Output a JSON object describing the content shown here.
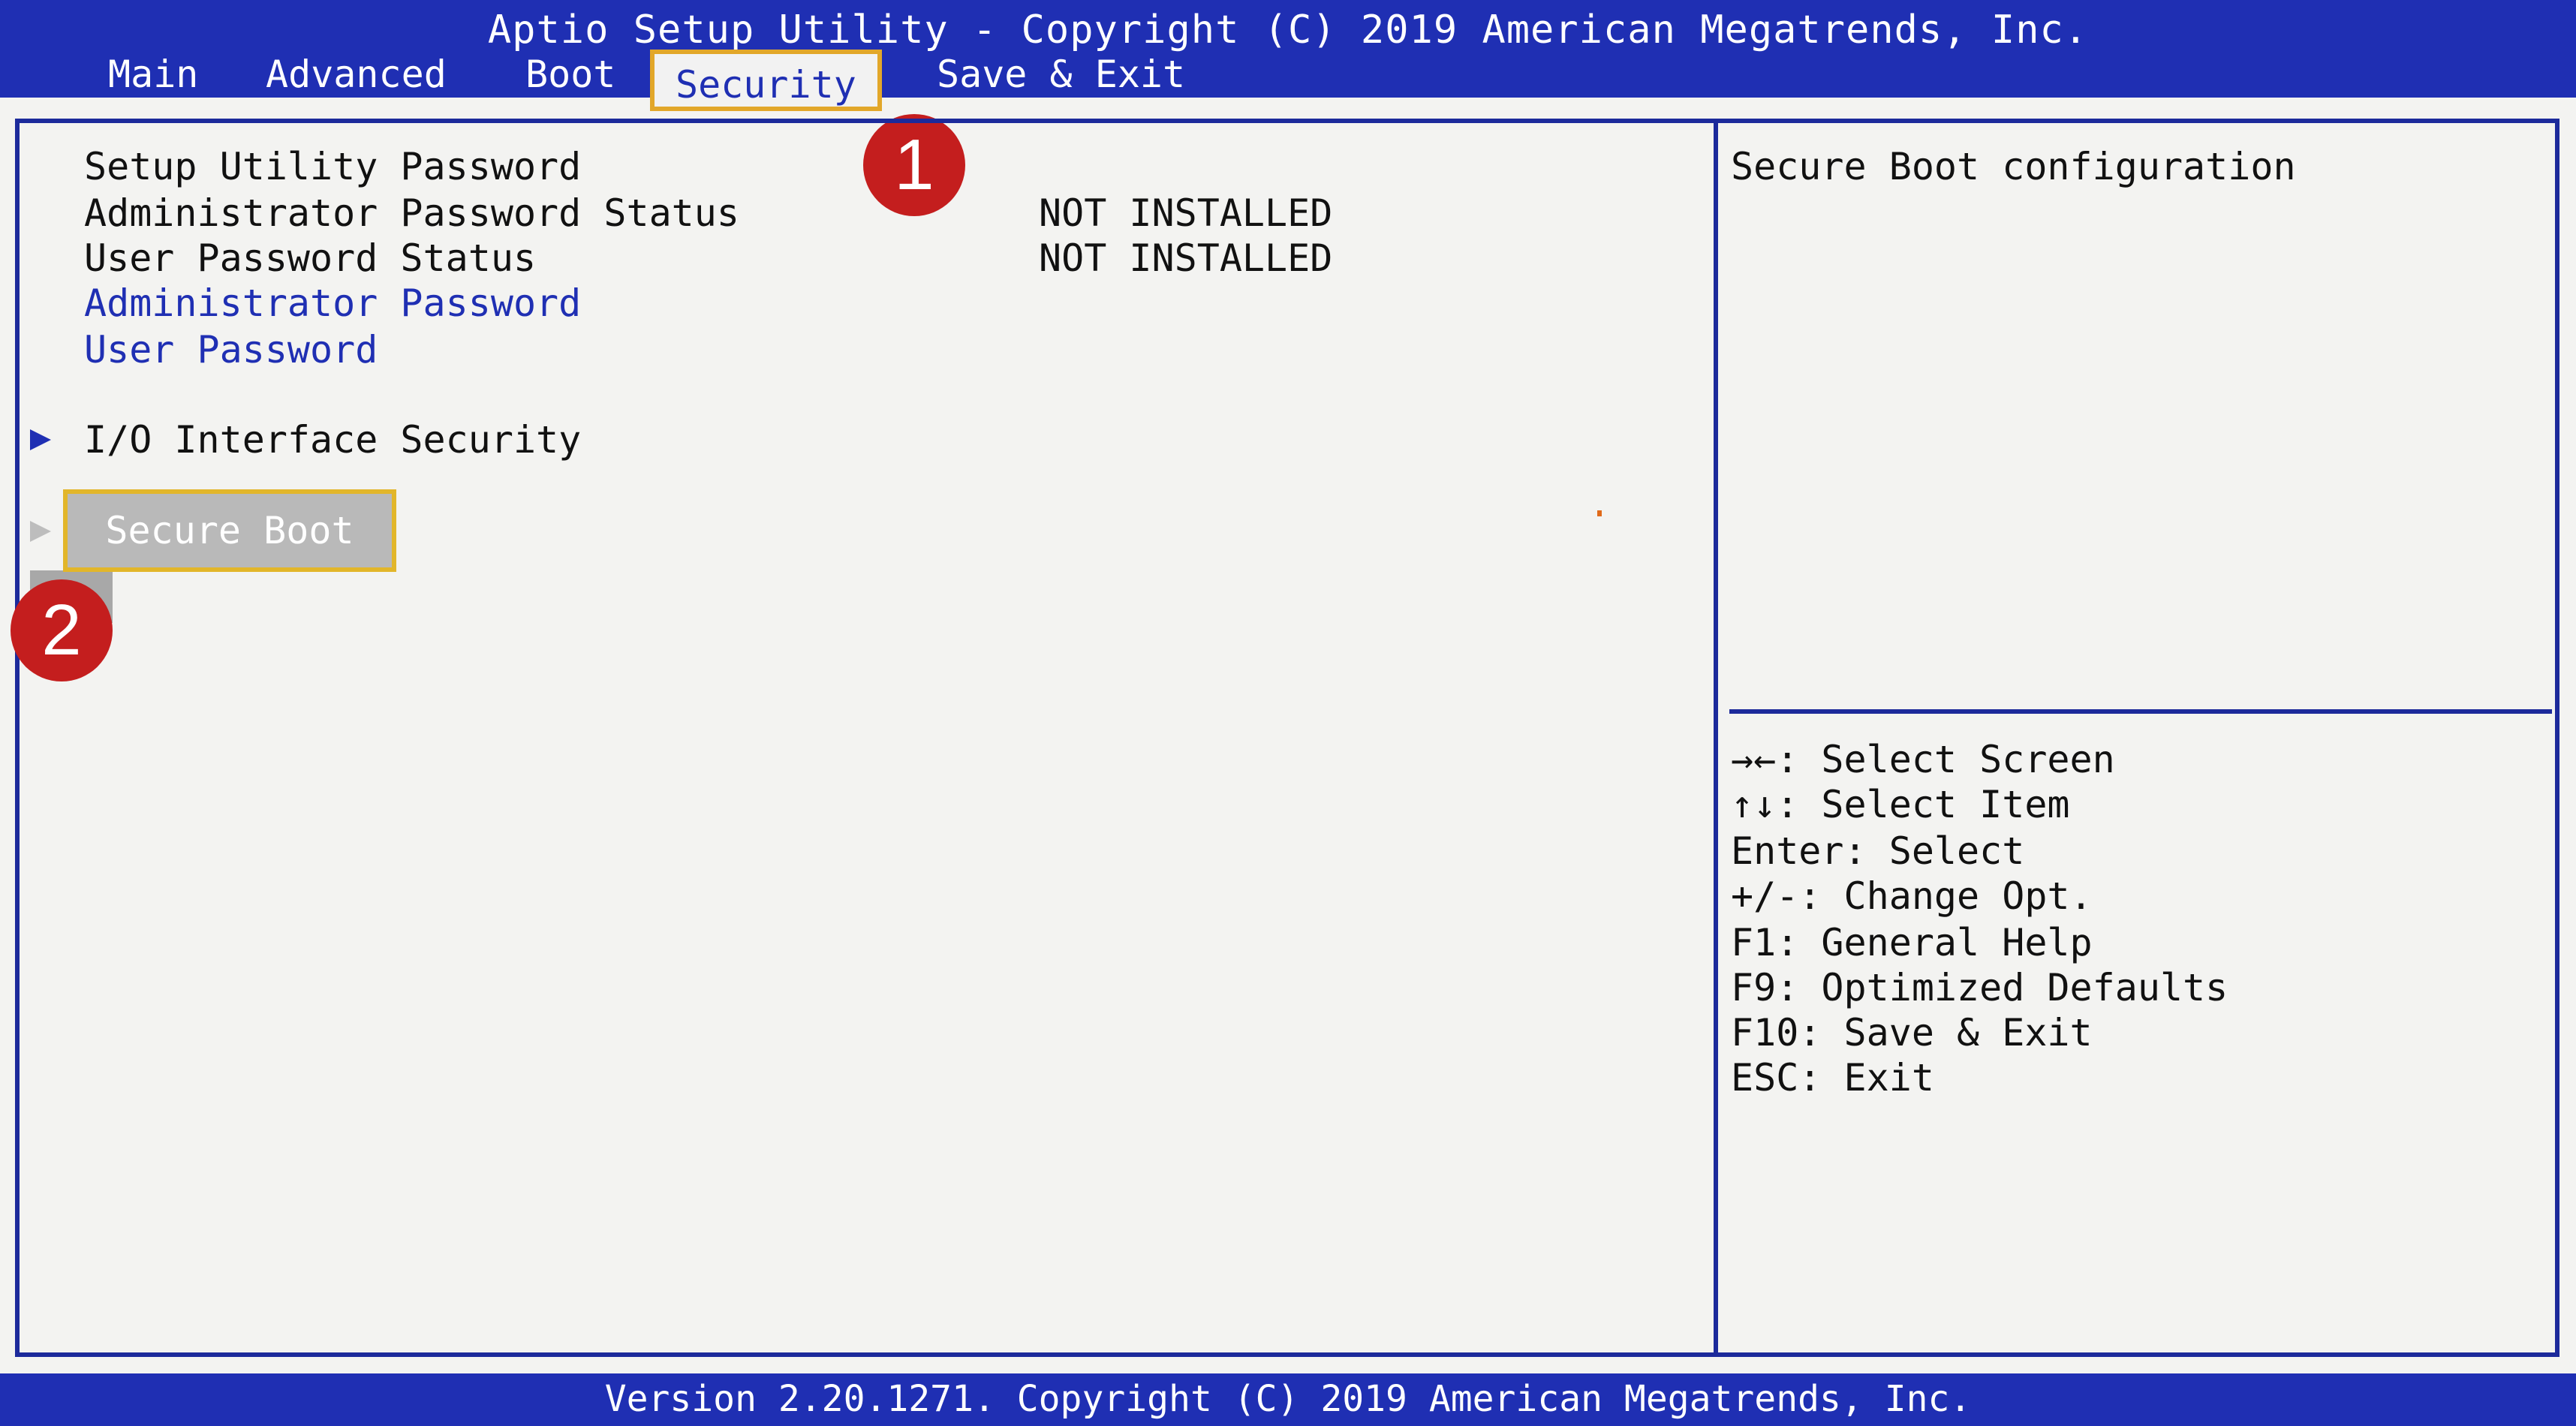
{
  "header": {
    "title": "Aptio Setup Utility - Copyright (C) 2019 American Megatrends, Inc."
  },
  "tabs": [
    {
      "label": "Main"
    },
    {
      "label": "Advanced"
    },
    {
      "label": "Boot"
    },
    {
      "label": "Security"
    },
    {
      "label": "Save & Exit"
    }
  ],
  "security": {
    "setup_password_label": "Setup Utility Password",
    "admin_status_label": "Administrator Password Status",
    "admin_status_value": "NOT INSTALLED",
    "user_status_label": "User Password Status",
    "user_status_value": "NOT INSTALLED",
    "admin_password_label": "Administrator Password",
    "user_password_label": "User Password",
    "io_security_label": "I/O Interface Security",
    "secure_boot_label": "Secure Boot"
  },
  "help": {
    "text": "Secure Boot configuration"
  },
  "keys": [
    "→←: Select Screen",
    "↑↓: Select Item",
    "Enter: Select",
    "+/-: Change Opt.",
    "F1: General Help",
    "F9: Optimized Defaults",
    "F10: Save & Exit",
    "ESC: Exit"
  ],
  "annotations": {
    "step1": "1",
    "step2": "2"
  },
  "footer": {
    "version": "Version 2.20.1271. Copyright (C) 2019 American Megatrends, Inc."
  },
  "colors": {
    "bios_blue": "#1f2fb3",
    "highlight_border": "#e2a72a",
    "annotation_red": "#c41e1e"
  }
}
